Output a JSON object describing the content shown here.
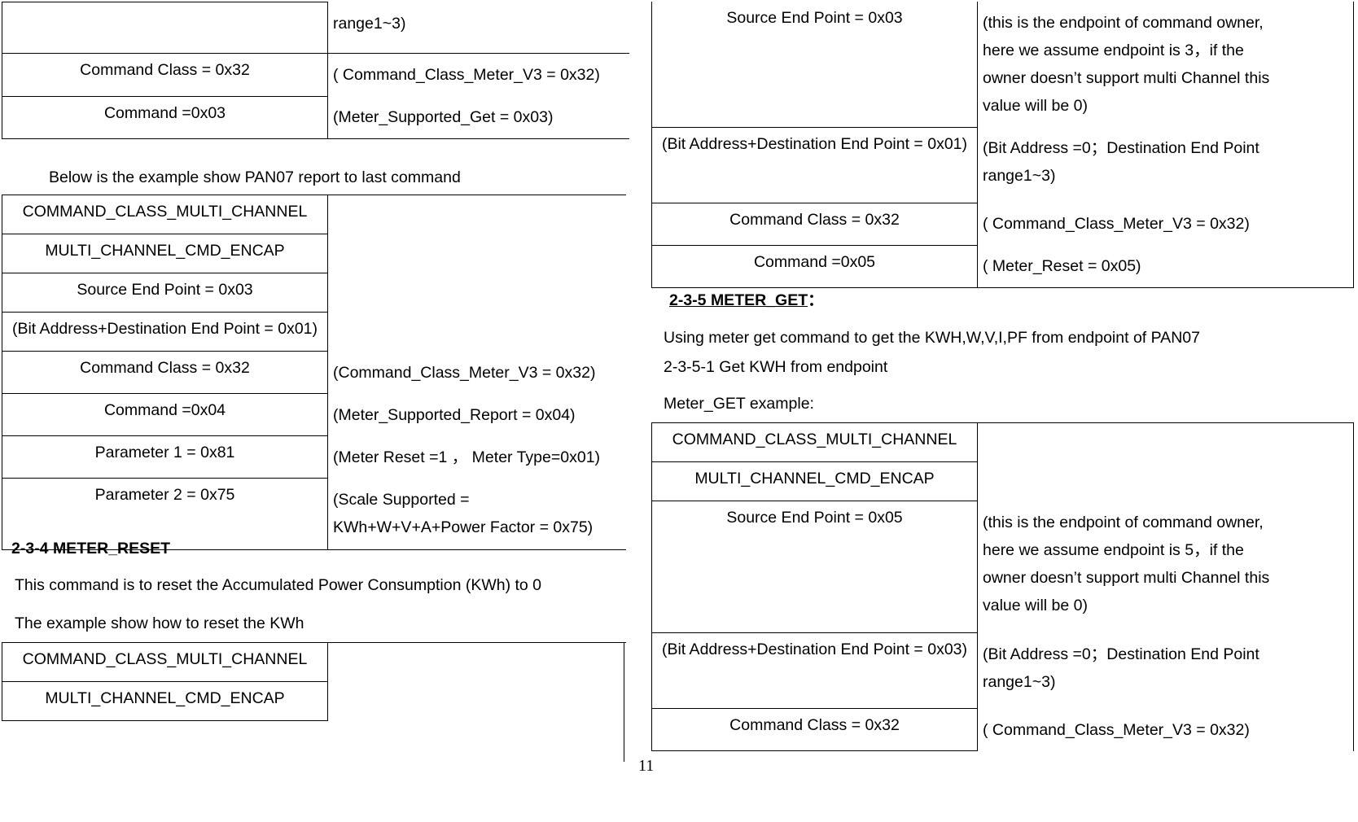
{
  "page": {
    "number": "11"
  },
  "left_column": {
    "table_meter_supported_get": {
      "name": "meter-supported-get-table",
      "rows": [
        {
          "left": "",
          "right": [
            "range1~3)"
          ]
        },
        {
          "left": "Command Class = 0x32",
          "right": [
            "( Command_Class_Meter_V3 = 0x32)"
          ]
        },
        {
          "left": "Command =0x03",
          "right": [
            "(Meter_Supported_Get = 0x03)"
          ]
        }
      ]
    },
    "intro_text": "Below is the example show PAN07 report to last command",
    "table_meter_supported_report": {
      "name": "meter-supported-report-table",
      "rows": [
        {
          "left": "COMMAND_CLASS_MULTI_CHANNEL",
          "right": []
        },
        {
          "left": "MULTI_CHANNEL_CMD_ENCAP",
          "right": []
        },
        {
          "left": "Source End Point = 0x03",
          "right": []
        },
        {
          "left": "(Bit Address+Destination End Point = 0x01)",
          "right": []
        },
        {
          "left": "Command Class = 0x32",
          "right": [
            "(Command_Class_Meter_V3 = 0x32)"
          ]
        },
        {
          "left": "Command =0x04",
          "right": [
            "(Meter_Supported_Report = 0x04)"
          ]
        },
        {
          "left": "Parameter 1 = 0x81",
          "right": [
            "(Meter Reset =1 ，  Meter Type=0x01)"
          ]
        },
        {
          "left": "Parameter 2 = 0x75",
          "right": [
            "(Scale Supported =",
            "KWh+W+V+A+Power Factor = 0x75)"
          ]
        }
      ]
    },
    "heading_meter_reset": "2-3-4 METER_RESET",
    "body_1": "This command is to reset the Accumulated Power Consumption (KWh) to 0",
    "body_2": "The example show how to reset the KWh",
    "table_meter_reset_example": {
      "name": "meter-reset-example-table",
      "rows": [
        {
          "left": "COMMAND_CLASS_MULTI_CHANNEL",
          "right": []
        },
        {
          "left": "MULTI_CHANNEL_CMD_ENCAP",
          "right": []
        }
      ]
    }
  },
  "right_column": {
    "table_meter_reset_continued": {
      "name": "meter-reset-continued-table",
      "rows": [
        {
          "left": "Source End Point = 0x03",
          "right": [
            "(this is the endpoint of command owner,",
            "here we assume endpoint is 3，if the",
            "owner doesn’t support multi Channel this",
            "value will be 0)"
          ]
        },
        {
          "left": "(Bit Address+Destination End Point = 0x01)",
          "right": [
            "(Bit Address =0；Destination End Point",
            "range1~3)"
          ]
        },
        {
          "left": "Command Class = 0x32",
          "right": [
            "( Command_Class_Meter_V3 = 0x32)"
          ]
        },
        {
          "left": "Command =0x05",
          "right": [
            "( Meter_Reset = 0x05)"
          ]
        }
      ]
    },
    "heading_meter_get_number": "2-3-5 METER_GET",
    "heading_meter_get_suffix": "：",
    "body_1": "Using meter get command to get the KWH,W,V,I,PF from endpoint of  PAN07",
    "body_2": "2-3-5-1 Get KWH from endpoint",
    "body_3": "Meter_GET example:",
    "table_meter_get_example": {
      "name": "meter-get-example-table",
      "rows": [
        {
          "left": "COMMAND_CLASS_MULTI_CHANNEL",
          "right": []
        },
        {
          "left": "MULTI_CHANNEL_CMD_ENCAP",
          "right": []
        },
        {
          "left": "Source End Point = 0x05",
          "right": [
            "(this is the endpoint of command owner,",
            "here we assume endpoint is 5，if the",
            "owner doesn’t support multi Channel this",
            "value will be 0)"
          ]
        },
        {
          "left": "(Bit Address+Destination End Point = 0x03)",
          "right": [
            "(Bit Address =0；Destination End Point",
            "range1~3)"
          ]
        },
        {
          "left": "Command Class = 0x32",
          "right": [
            "( Command_Class_Meter_V3 = 0x32)"
          ]
        }
      ]
    }
  }
}
